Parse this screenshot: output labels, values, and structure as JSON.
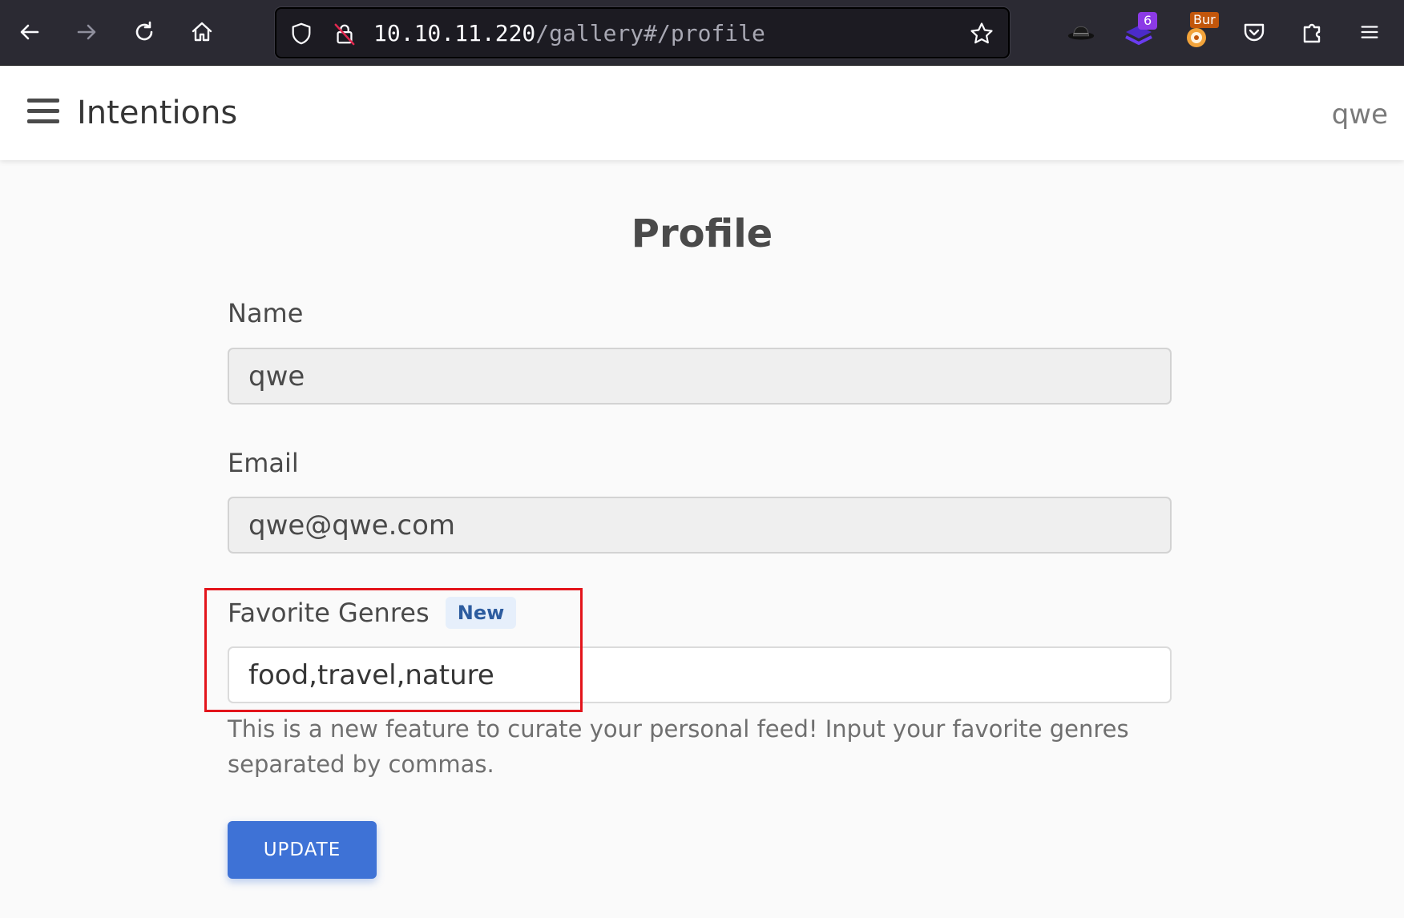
{
  "browser": {
    "url_host": "10.10.11.220",
    "url_path": "/gallery#/profile",
    "extensions": [
      {
        "name": "hat-extension-icon"
      },
      {
        "name": "stack-extension-icon",
        "badge": "6"
      },
      {
        "name": "burp-extension-icon",
        "label": "Bur"
      },
      {
        "name": "pocket-icon"
      },
      {
        "name": "extensions-puzzle-icon"
      }
    ],
    "colors": {
      "chrome_bg": "#2b2a33",
      "url_bg": "#1c1b22"
    }
  },
  "header": {
    "title": "Intentions",
    "username": "qwe"
  },
  "profile": {
    "heading": "Profile",
    "name_label": "Name",
    "name_value": "qwe",
    "email_label": "Email",
    "email_value": "qwe@qwe.com",
    "genres_label": "Favorite Genres",
    "genres_tag": "New",
    "genres_value": "food,travel,nature",
    "help_text": "This is a new feature to curate your personal feed! Input your favorite genres separated by commas.",
    "update_label": "UPDATE"
  },
  "colors": {
    "accent": "#3e72d6",
    "annotation": "#e3141b",
    "tag_bg": "#e6effb",
    "tag_text": "#2d5c9f"
  }
}
